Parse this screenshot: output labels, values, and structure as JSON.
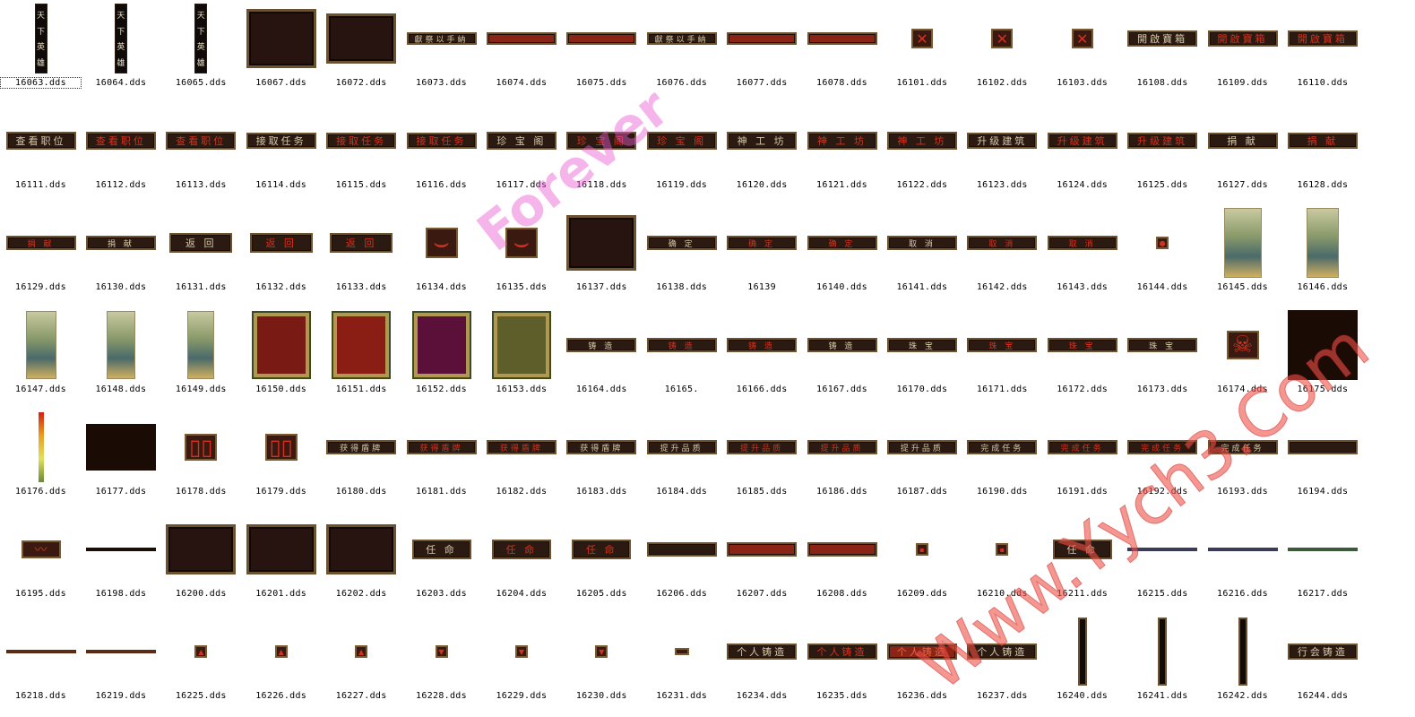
{
  "files": [
    {
      "name": "16063.dds",
      "kind": "scroll",
      "text": "天下英雄",
      "w": 14,
      "h": 78,
      "selected": true
    },
    {
      "name": "16064.dds",
      "kind": "scroll",
      "text": "天下英雄",
      "w": 14,
      "h": 78
    },
    {
      "name": "16065.dds",
      "kind": "scroll",
      "text": "天下英雄",
      "w": 14,
      "h": 78
    },
    {
      "name": "16067.dds",
      "kind": "panel",
      "w": 78,
      "h": 66
    },
    {
      "name": "16072.dds",
      "kind": "panel",
      "w": 78,
      "h": 56
    },
    {
      "name": "16073.dds",
      "kind": "btn",
      "text": "獻祭以手納",
      "w": 78,
      "h": 14
    },
    {
      "name": "16074.dds",
      "kind": "btn",
      "style": "redfill",
      "text": "",
      "w": 78,
      "h": 14
    },
    {
      "name": "16075.dds",
      "kind": "btn",
      "style": "redfill",
      "text": "",
      "w": 78,
      "h": 14
    },
    {
      "name": "16076.dds",
      "kind": "btn",
      "text": "獻祭以手納",
      "w": 78,
      "h": 14
    },
    {
      "name": "16077.dds",
      "kind": "btn",
      "style": "redfill",
      "text": "",
      "w": 78,
      "h": 14
    },
    {
      "name": "16078.dds",
      "kind": "btn",
      "style": "redfill",
      "text": "",
      "w": 78,
      "h": 14
    },
    {
      "name": "16101.dds",
      "kind": "icon",
      "text": "✕",
      "w": 24,
      "h": 22
    },
    {
      "name": "16102.dds",
      "kind": "icon",
      "text": "✕",
      "w": 24,
      "h": 22
    },
    {
      "name": "16103.dds",
      "kind": "icon",
      "text": "✕",
      "w": 24,
      "h": 22
    },
    {
      "name": "16108.dds",
      "kind": "btn",
      "text": "開啟寶箱",
      "w": 78,
      "h": 18
    },
    {
      "name": "16109.dds",
      "kind": "btn",
      "style": "red",
      "text": "開啟寶箱",
      "w": 78,
      "h": 18
    },
    {
      "name": "16110.dds",
      "kind": "btn",
      "style": "red",
      "text": "開啟寶箱",
      "w": 78,
      "h": 18
    },
    {
      "name": "16111.dds",
      "kind": "btn",
      "text": "查看职位",
      "w": 78,
      "h": 20
    },
    {
      "name": "16112.dds",
      "kind": "btn",
      "style": "red",
      "text": "查看职位",
      "w": 78,
      "h": 20
    },
    {
      "name": "16113.dds",
      "kind": "btn",
      "style": "red",
      "text": "查看职位",
      "w": 78,
      "h": 20
    },
    {
      "name": "16114.dds",
      "kind": "btn",
      "text": "接取任务",
      "w": 78,
      "h": 18
    },
    {
      "name": "16115.dds",
      "kind": "btn",
      "style": "red",
      "text": "接取任务",
      "w": 78,
      "h": 18
    },
    {
      "name": "16116.dds",
      "kind": "btn",
      "style": "red",
      "text": "接取任务",
      "w": 78,
      "h": 18
    },
    {
      "name": "16117.dds",
      "kind": "btn",
      "text": "珍 宝 阁",
      "w": 78,
      "h": 20
    },
    {
      "name": "16118.dds",
      "kind": "btn",
      "style": "red",
      "text": "珍 宝 阁",
      "w": 78,
      "h": 20
    },
    {
      "name": "16119.dds",
      "kind": "btn",
      "style": "red",
      "text": "珍 宝 阁",
      "w": 78,
      "h": 20
    },
    {
      "name": "16120.dds",
      "kind": "btn",
      "text": "神 工 坊",
      "w": 78,
      "h": 20
    },
    {
      "name": "16121.dds",
      "kind": "btn",
      "style": "red",
      "text": "神 工 坊",
      "w": 78,
      "h": 20
    },
    {
      "name": "16122.dds",
      "kind": "btn",
      "style": "red",
      "text": "神 工 坊",
      "w": 78,
      "h": 20
    },
    {
      "name": "16123.dds",
      "kind": "btn",
      "text": "升级建筑",
      "w": 78,
      "h": 18
    },
    {
      "name": "16124.dds",
      "kind": "btn",
      "style": "red",
      "text": "升级建筑",
      "w": 78,
      "h": 18
    },
    {
      "name": "16125.dds",
      "kind": "btn",
      "style": "red",
      "text": "升级建筑",
      "w": 78,
      "h": 18
    },
    {
      "name": "16127.dds",
      "kind": "btn",
      "text": "捐 献",
      "w": 78,
      "h": 18
    },
    {
      "name": "16128.dds",
      "kind": "btn",
      "style": "red",
      "text": "捐 献",
      "w": 78,
      "h": 18
    },
    {
      "name": "16129.dds",
      "kind": "btn",
      "style": "red",
      "text": "捐 献",
      "w": 78,
      "h": 16
    },
    {
      "name": "16130.dds",
      "kind": "btn",
      "text": "捐 献",
      "w": 78,
      "h": 16
    },
    {
      "name": "16131.dds",
      "kind": "btn",
      "text": "返 回",
      "w": 70,
      "h": 22
    },
    {
      "name": "16132.dds",
      "kind": "btn",
      "style": "red",
      "text": "返 回",
      "w": 70,
      "h": 22
    },
    {
      "name": "16133.dds",
      "kind": "btn",
      "style": "red",
      "text": "返 回",
      "w": 70,
      "h": 22
    },
    {
      "name": "16134.dds",
      "kind": "icon",
      "text": "⌣",
      "w": 36,
      "h": 34
    },
    {
      "name": "16135.dds",
      "kind": "icon",
      "text": "⌣",
      "w": 36,
      "h": 34
    },
    {
      "name": "16137.dds",
      "kind": "panel",
      "w": 78,
      "h": 62
    },
    {
      "name": "16138.dds",
      "kind": "btn",
      "text": "确 定",
      "w": 78,
      "h": 16
    },
    {
      "name": "16139",
      "kind": "btn",
      "style": "red",
      "text": "确 定",
      "w": 78,
      "h": 16
    },
    {
      "name": "16140.dds",
      "kind": "btn",
      "style": "red",
      "text": "确 定",
      "w": 78,
      "h": 16
    },
    {
      "name": "16141.dds",
      "kind": "btn",
      "text": "取 消",
      "w": 78,
      "h": 16
    },
    {
      "name": "16142.dds",
      "kind": "btn",
      "style": "red",
      "text": "取 消",
      "w": 78,
      "h": 16
    },
    {
      "name": "16143.dds",
      "kind": "btn",
      "style": "red",
      "text": "取 消",
      "w": 78,
      "h": 16
    },
    {
      "name": "16144.dds",
      "kind": "icon",
      "text": "●",
      "w": 14,
      "h": 14
    },
    {
      "name": "16145.dds",
      "kind": "tower",
      "w": 42,
      "h": 78
    },
    {
      "name": "16146.dds",
      "kind": "tower",
      "w": 36,
      "h": 78
    },
    {
      "name": "16147.dds",
      "kind": "tower",
      "w": 34,
      "h": 76
    },
    {
      "name": "16148.dds",
      "kind": "tower",
      "w": 32,
      "h": 76
    },
    {
      "name": "16149.dds",
      "kind": "tower",
      "w": 30,
      "h": 76
    },
    {
      "name": "16150.dds",
      "kind": "seal",
      "color": "#7a1a14",
      "w": 66,
      "h": 76
    },
    {
      "name": "16151.dds",
      "kind": "seal",
      "color": "#8a1e14",
      "w": 66,
      "h": 76
    },
    {
      "name": "16152.dds",
      "kind": "seal",
      "color": "#5a1038",
      "w": 66,
      "h": 76
    },
    {
      "name": "16153.dds",
      "kind": "seal",
      "color": "#5e5e2a",
      "w": 66,
      "h": 76
    },
    {
      "name": "16164.dds",
      "kind": "btn",
      "text": "铸 造",
      "w": 78,
      "h": 16
    },
    {
      "name": "16165.",
      "kind": "btn",
      "style": "red",
      "text": "铸 造",
      "w": 78,
      "h": 16
    },
    {
      "name": "16166.dds",
      "kind": "btn",
      "style": "red",
      "text": "铸 造",
      "w": 78,
      "h": 16
    },
    {
      "name": "16167.dds",
      "kind": "btn",
      "text": "铸 造",
      "w": 78,
      "h": 16
    },
    {
      "name": "16170.dds",
      "kind": "btn",
      "text": "珠 宝",
      "w": 78,
      "h": 16
    },
    {
      "name": "16171.dds",
      "kind": "btn",
      "style": "red",
      "text": "珠 宝",
      "w": 78,
      "h": 16
    },
    {
      "name": "16172.dds",
      "kind": "btn",
      "style": "red",
      "text": "珠 宝",
      "w": 78,
      "h": 16
    },
    {
      "name": "16173.dds",
      "kind": "btn",
      "text": "珠 宝",
      "w": 78,
      "h": 16
    },
    {
      "name": "16174.dds",
      "kind": "icon",
      "text": "☠",
      "w": 36,
      "h": 32
    },
    {
      "name": "16175.dds",
      "kind": "dark",
      "w": 78,
      "h": 78
    },
    {
      "name": "16176.dds",
      "kind": "gradient",
      "w": 6,
      "h": 78
    },
    {
      "name": "16177.dds",
      "kind": "dark",
      "w": 78,
      "h": 52
    },
    {
      "name": "16178.dds",
      "kind": "icon",
      "text": "▯▯",
      "w": 36,
      "h": 30
    },
    {
      "name": "16179.dds",
      "kind": "icon",
      "text": "▯▯",
      "w": 36,
      "h": 30
    },
    {
      "name": "16180.dds",
      "kind": "btn",
      "text": "获得盾牌",
      "w": 78,
      "h": 16
    },
    {
      "name": "16181.dds",
      "kind": "btn",
      "style": "red",
      "text": "获得盾牌",
      "w": 78,
      "h": 16
    },
    {
      "name": "16182.dds",
      "kind": "btn",
      "style": "red",
      "text": "获得盾牌",
      "w": 78,
      "h": 16
    },
    {
      "name": "16183.dds",
      "kind": "btn",
      "text": "获得盾牌",
      "w": 78,
      "h": 16
    },
    {
      "name": "16184.dds",
      "kind": "btn",
      "text": "提升品质",
      "w": 78,
      "h": 16
    },
    {
      "name": "16185.dds",
      "kind": "btn",
      "style": "red",
      "text": "提升品质",
      "w": 78,
      "h": 16
    },
    {
      "name": "16186.dds",
      "kind": "btn",
      "style": "red",
      "text": "提升品质",
      "w": 78,
      "h": 16
    },
    {
      "name": "16187.dds",
      "kind": "btn",
      "text": "提升品质",
      "w": 78,
      "h": 16
    },
    {
      "name": "16190.dds",
      "kind": "btn",
      "text": "完成任务",
      "w": 78,
      "h": 16
    },
    {
      "name": "16191.dds",
      "kind": "btn",
      "style": "red",
      "text": "完成任务",
      "w": 78,
      "h": 16
    },
    {
      "name": "16192.dds",
      "kind": "btn",
      "style": "red",
      "text": "完成任务",
      "w": 78,
      "h": 16
    },
    {
      "name": "16193.dds",
      "kind": "btn",
      "text": "完成任务",
      "w": 78,
      "h": 16
    },
    {
      "name": "16194.dds",
      "kind": "btn",
      "text": "",
      "w": 78,
      "h": 16
    },
    {
      "name": "16195.dds",
      "kind": "icon",
      "text": "〰",
      "w": 44,
      "h": 20
    },
    {
      "name": "16198.dds",
      "kind": "bar",
      "color": "#1a0c06",
      "w": 78,
      "h": 4
    },
    {
      "name": "16200.dds",
      "kind": "panel",
      "w": 78,
      "h": 56
    },
    {
      "name": "16201.dds",
      "kind": "panel",
      "w": 78,
      "h": 56
    },
    {
      "name": "16202.dds",
      "kind": "panel",
      "w": 78,
      "h": 56
    },
    {
      "name": "16203.dds",
      "kind": "btn",
      "text": "任 命",
      "w": 66,
      "h": 22
    },
    {
      "name": "16204.dds",
      "kind": "btn",
      "style": "red",
      "text": "任 命",
      "w": 66,
      "h": 22
    },
    {
      "name": "16205.dds",
      "kind": "btn",
      "style": "red",
      "text": "任 命",
      "w": 66,
      "h": 22
    },
    {
      "name": "16206.dds",
      "kind": "btn",
      "text": "",
      "w": 78,
      "h": 16
    },
    {
      "name": "16207.dds",
      "kind": "btn",
      "style": "redfill",
      "text": "",
      "w": 78,
      "h": 16
    },
    {
      "name": "16208.dds",
      "kind": "btn",
      "style": "redfill",
      "text": "",
      "w": 78,
      "h": 16
    },
    {
      "name": "16209.dds",
      "kind": "icon",
      "text": "▪",
      "w": 14,
      "h": 14
    },
    {
      "name": "16210.dds",
      "kind": "icon",
      "text": "▪",
      "w": 14,
      "h": 14
    },
    {
      "name": "16211.dds",
      "kind": "btn",
      "text": "任 命",
      "w": 66,
      "h": 22
    },
    {
      "name": "16215.dds",
      "kind": "bar",
      "color": "#3a3a5a",
      "w": 78,
      "h": 4
    },
    {
      "name": "16216.dds",
      "kind": "bar",
      "color": "#3a3a5a",
      "w": 78,
      "h": 4
    },
    {
      "name": "16217.dds",
      "kind": "bar",
      "color": "#3a5a3a",
      "w": 78,
      "h": 4
    },
    {
      "name": "16218.dds",
      "kind": "bar",
      "color": "#5a2a14",
      "w": 78,
      "h": 4
    },
    {
      "name": "16219.dds",
      "kind": "bar",
      "color": "#5a2a14",
      "w": 78,
      "h": 4
    },
    {
      "name": "16225.dds",
      "kind": "icon",
      "text": "▲",
      "w": 14,
      "h": 14
    },
    {
      "name": "16226.dds",
      "kind": "icon",
      "text": "▲",
      "w": 14,
      "h": 14
    },
    {
      "name": "16227.dds",
      "kind": "icon",
      "text": "▲",
      "w": 14,
      "h": 14
    },
    {
      "name": "16228.dds",
      "kind": "icon",
      "text": "▼",
      "w": 14,
      "h": 14
    },
    {
      "name": "16229.dds",
      "kind": "icon",
      "text": "▼",
      "w": 14,
      "h": 14
    },
    {
      "name": "16230.dds",
      "kind": "icon",
      "text": "▼",
      "w": 14,
      "h": 14
    },
    {
      "name": "16231.dds",
      "kind": "icon",
      "text": "",
      "w": 16,
      "h": 8
    },
    {
      "name": "16234.dds",
      "kind": "btn",
      "text": "个人铸造",
      "w": 78,
      "h": 18
    },
    {
      "name": "16235.dds",
      "kind": "btn",
      "style": "red",
      "text": "个人铸造",
      "w": 78,
      "h": 18
    },
    {
      "name": "16236.dds",
      "kind": "btn",
      "style": "redfill",
      "text": "个人铸造",
      "w": 78,
      "h": 18
    },
    {
      "name": "16237.dds",
      "kind": "btn",
      "text": "个人铸造",
      "w": 78,
      "h": 18
    },
    {
      "name": "16240.dds",
      "kind": "scroll",
      "text": "",
      "w": 10,
      "h": 76
    },
    {
      "name": "16241.dds",
      "kind": "scroll",
      "text": "",
      "w": 10,
      "h": 76
    },
    {
      "name": "16242.dds",
      "kind": "scroll",
      "text": "",
      "w": 10,
      "h": 76
    },
    {
      "name": "16244.dds",
      "kind": "btn",
      "text": "行会铸造",
      "w": 78,
      "h": 18
    }
  ],
  "watermark_pink": "Forever",
  "watermark_red": "Www.Yych3.Com"
}
